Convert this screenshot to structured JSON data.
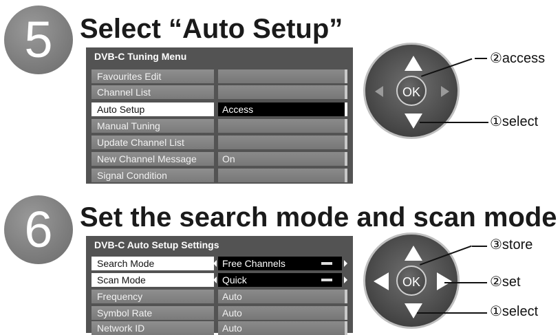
{
  "step5": {
    "number": "5",
    "title": "Select “Auto Setup”",
    "menu": {
      "title": "DVB-C Tuning Menu",
      "rows": [
        {
          "label": "Favourites Edit",
          "value": ""
        },
        {
          "label": "Channel List",
          "value": ""
        },
        {
          "label": "Auto Setup",
          "value": "Access"
        },
        {
          "label": "Manual Tuning",
          "value": ""
        },
        {
          "label": "Update Channel List",
          "value": ""
        },
        {
          "label": "New Channel Message",
          "value": "On"
        },
        {
          "label": "Signal Condition",
          "value": ""
        }
      ]
    },
    "remote": {
      "ok": "OK"
    },
    "callouts": {
      "access": "②access",
      "select": "①select"
    }
  },
  "step6": {
    "number": "6",
    "title": "Set the search mode and scan mode",
    "menu": {
      "title": "DVB-C Auto Setup Settings",
      "rows": [
        {
          "label": "Search Mode",
          "value": "Free Channels"
        },
        {
          "label": "Scan Mode",
          "value": "Quick"
        },
        {
          "label": "Frequency",
          "value": "Auto"
        },
        {
          "label": "Symbol Rate",
          "value": "Auto"
        },
        {
          "label": "Network ID",
          "value": "Auto"
        }
      ]
    },
    "remote": {
      "ok": "OK"
    },
    "callouts": {
      "store": "③store",
      "set": "②set",
      "select": "①select"
    }
  }
}
